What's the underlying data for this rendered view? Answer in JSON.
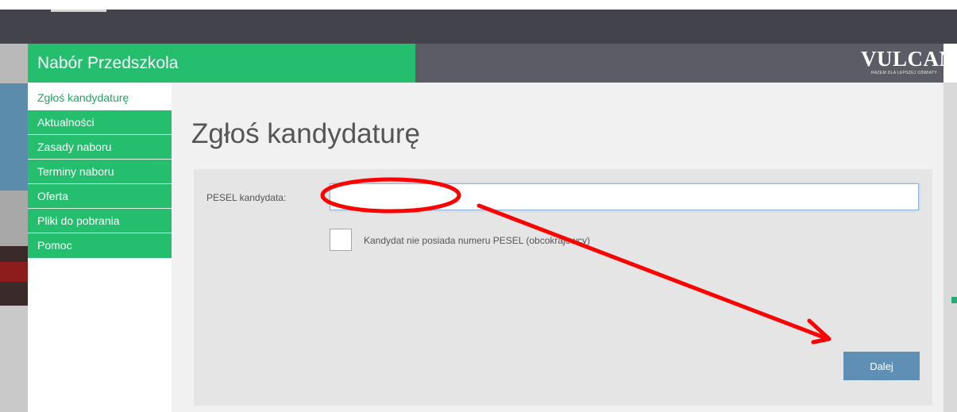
{
  "app": {
    "title": "Nabór Przedszkola",
    "brand": "VULCAN",
    "brand_tagline": "RAZEM DLA LEPSZEJ OŚWIATY"
  },
  "sidebar": {
    "items": [
      {
        "label": "Zgłoś kandydaturę",
        "active": true
      },
      {
        "label": "Aktualności"
      },
      {
        "label": "Zasady naboru"
      },
      {
        "label": "Terminy naboru"
      },
      {
        "label": "Oferta"
      },
      {
        "label": "Pliki do pobrania"
      },
      {
        "label": "Pomoc"
      }
    ]
  },
  "main": {
    "title": "Zgłoś kandydaturę",
    "form": {
      "pesel_label": "PESEL kandydata:",
      "pesel_value": "",
      "no_pesel_checkbox_label": "Kandydat nie posiada numeru PESEL (obcokrajowcy)",
      "no_pesel_checked": false,
      "next_button": "Dalej"
    }
  },
  "colors": {
    "brand_green": "#24be6e",
    "header_dark": "#5b5c65",
    "button_blue": "#5f8fb4",
    "annotation_red": "#ff0000"
  }
}
